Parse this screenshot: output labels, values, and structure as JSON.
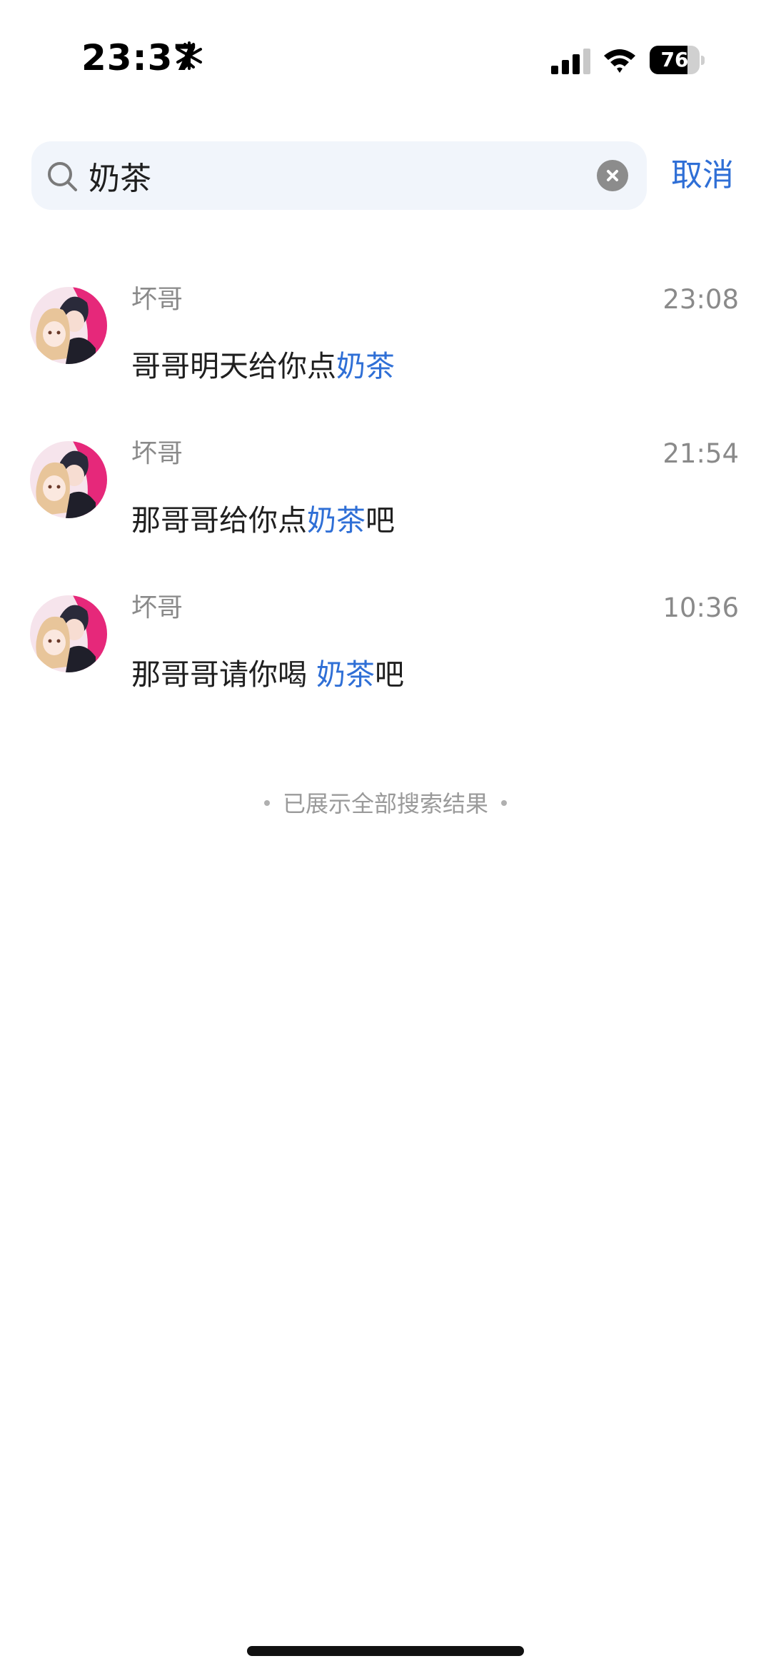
{
  "status_bar": {
    "time": "23:37",
    "battery_level": "76",
    "battery_fraction": 0.76,
    "icons": [
      "snowflake-icon",
      "cellular-signal-icon",
      "wifi-icon",
      "battery-icon"
    ]
  },
  "search": {
    "query": "奶茶",
    "cancel_label": "取消",
    "icons": [
      "search-icon",
      "clear-icon"
    ]
  },
  "results": [
    {
      "sender": "坏哥",
      "time": "23:08",
      "message_before": "哥哥明天给你点",
      "message_match": "奶茶",
      "message_after": ""
    },
    {
      "sender": "坏哥",
      "time": "21:54",
      "message_before": "那哥哥给你点",
      "message_match": "奶茶",
      "message_after": "吧"
    },
    {
      "sender": "坏哥",
      "time": "10:36",
      "message_before": "那哥哥请你喝 ",
      "message_match": "奶茶",
      "message_after": "吧"
    }
  ],
  "footer_note": "已展示全部搜索结果",
  "colors": {
    "accent": "#2f6fd6",
    "secondary_text": "#8a8a8a",
    "search_background": "#f1f5fb",
    "avatar_pink": "#e6287a"
  }
}
